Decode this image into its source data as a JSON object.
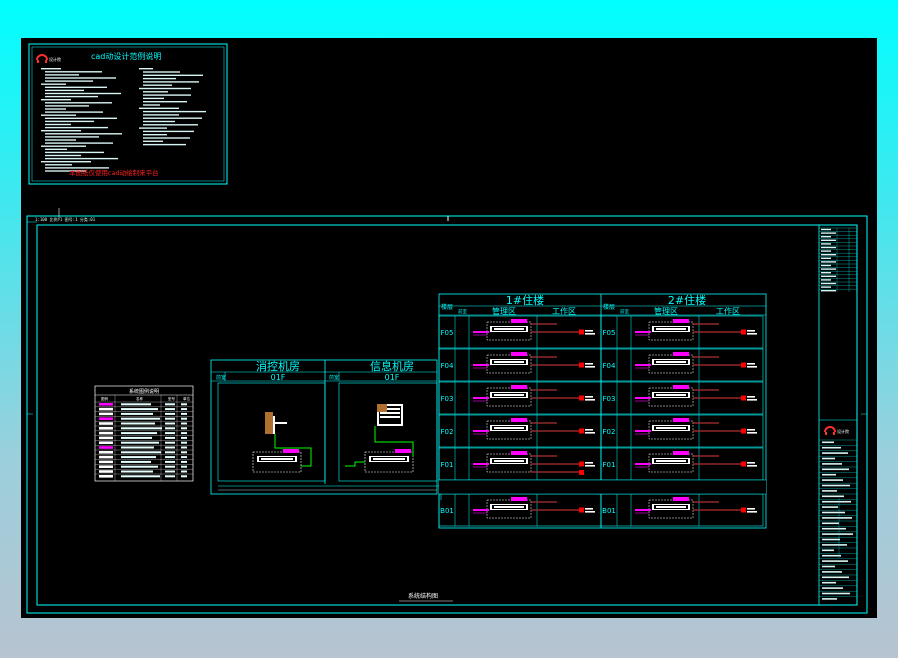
{
  "notes": {
    "title": "cad动设计范例说明",
    "warning": "本图纸仅使用cad动绘制来平台",
    "logo_text": "设计院"
  },
  "header": {
    "scale_text": "1:100  比例:1   图号:1   分类:01"
  },
  "rooms": [
    {
      "title": "消控机房",
      "floor": "01F",
      "side": "前室"
    },
    {
      "title": "信息机房",
      "floor": "01F",
      "side": "前室"
    }
  ],
  "buildings": [
    {
      "title": "1#住楼",
      "col_floor": "楼层",
      "col_side": "前室",
      "col_mgmt": "管理区",
      "col_work": "工作区"
    },
    {
      "title": "2#住楼",
      "col_floor": "楼层",
      "col_side": "前室",
      "col_mgmt": "管理区",
      "col_work": "工作区"
    }
  ],
  "floors": [
    "F05",
    "F04",
    "F03",
    "F02",
    "F01",
    "B01"
  ],
  "legend": {
    "title": "系统图例说明",
    "headers": [
      "图例",
      "名称",
      "型号",
      "单位"
    ]
  },
  "bottom_caption": "系统结构图",
  "titleblock": {
    "company": "设计院"
  },
  "colors": {
    "frame": "#00ffff",
    "magenta": "#ff00ff",
    "green": "#00ff00",
    "red": "#ff0000",
    "darkred": "#b03030",
    "white": "#ffffff"
  }
}
